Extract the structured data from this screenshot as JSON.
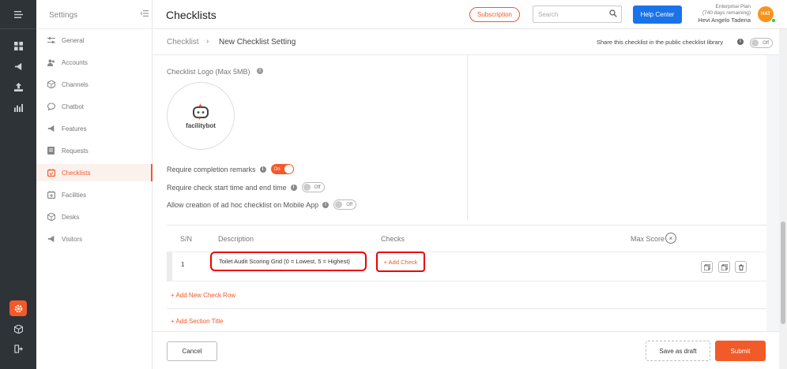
{
  "settings": {
    "title": "Settings",
    "items": [
      {
        "label": "General",
        "icon": "sliders-icon"
      },
      {
        "label": "Accounts",
        "icon": "users-icon"
      },
      {
        "label": "Channels",
        "icon": "box-icon"
      },
      {
        "label": "Chatbot",
        "icon": "chat-icon"
      },
      {
        "label": "Features",
        "icon": "megaphone-icon"
      },
      {
        "label": "Requests",
        "icon": "request-icon"
      },
      {
        "label": "Checklists",
        "icon": "calendar-check-icon",
        "active": true
      },
      {
        "label": "Facilities",
        "icon": "building-icon"
      },
      {
        "label": "Desks",
        "icon": "desk-icon"
      },
      {
        "label": "Visitors",
        "icon": "visitor-icon"
      }
    ]
  },
  "topbar": {
    "title": "Checklists",
    "subscription_label": "Subscription",
    "search_placeholder": "Search",
    "help_label": "Help Center",
    "plan_name": "Enterprise Plan",
    "plan_remaining": "(740 days remaining)",
    "user_name": "Hevi Angelo Tadena",
    "avatar_initials": "HAT"
  },
  "breadcrumb": {
    "root": "Checklist",
    "separator": "›",
    "current": "New Checklist Setting"
  },
  "share": {
    "label": "Share this checklist in the public checklist library",
    "toggle": "Off"
  },
  "logo": {
    "label": "Checklist Logo (Max 5MB)",
    "brand_main": "facility",
    "brand_accent": "bot"
  },
  "options": [
    {
      "label": "Require completion remarks",
      "state": "On"
    },
    {
      "label": "Require check start time and end time",
      "state": "Off"
    },
    {
      "label": "Allow creation of ad hoc checklist on Mobile App",
      "state": "Off"
    }
  ],
  "table": {
    "headers": {
      "sn": "S/N",
      "description": "Description",
      "checks": "Checks",
      "max_score": "Max Score"
    },
    "rows": [
      {
        "sn": "1",
        "description": "Toilet Audit Scoring Grid (0 = Lowest, 5 = Highest)",
        "add_check": "+ Add Check"
      }
    ],
    "add_row": "+ Add New Check Row",
    "add_section": "+ Add Section Title"
  },
  "footer": {
    "cancel": "Cancel",
    "save_draft": "Save as draft",
    "submit": "Submit"
  },
  "colors": {
    "accent": "#f25a29",
    "primary_blue": "#1a73e8",
    "rail_bg": "#2e3338",
    "highlight_red": "#e00000"
  }
}
